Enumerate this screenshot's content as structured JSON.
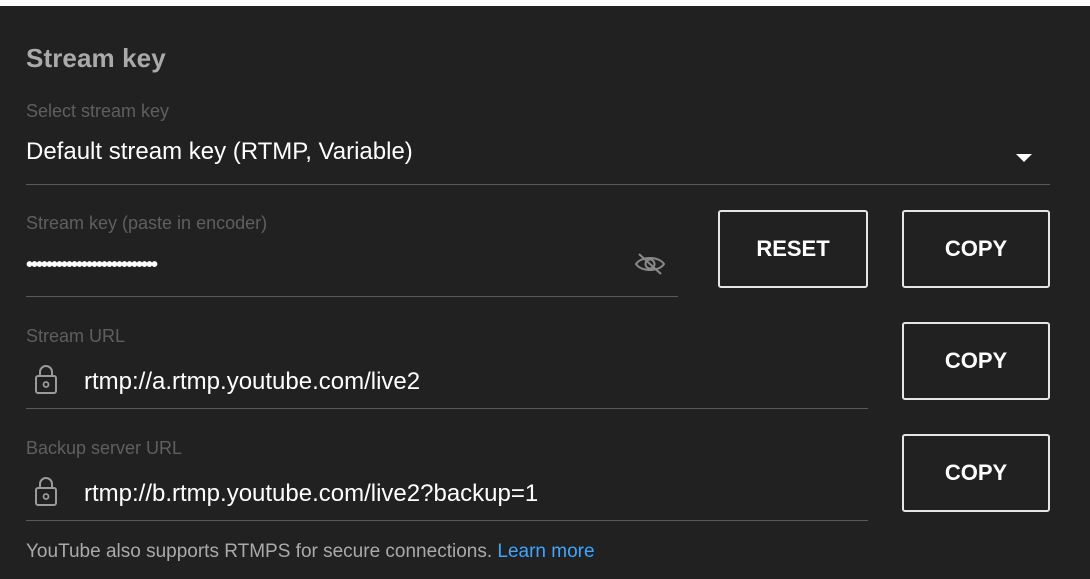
{
  "section": {
    "title": "Stream key"
  },
  "select_stream_key": {
    "label": "Select stream key",
    "value": "Default stream key (RTMP, Variable)"
  },
  "stream_key": {
    "label": "Stream key (paste in encoder)",
    "masked_value": "••••••••••••••••••••••••••",
    "reset_label": "RESET",
    "copy_label": "COPY"
  },
  "stream_url": {
    "label": "Stream URL",
    "value": "rtmp://a.rtmp.youtube.com/live2",
    "copy_label": "COPY"
  },
  "backup_url": {
    "label": "Backup server URL",
    "value": "rtmp://b.rtmp.youtube.com/live2?backup=1",
    "copy_label": "COPY"
  },
  "footer": {
    "text": "YouTube also supports RTMPS for secure connections. ",
    "link": "Learn more"
  },
  "colors": {
    "background": "#212121",
    "link": "#3ea6ff",
    "label": "#5f5f5f",
    "title": "#aaaaaa"
  },
  "icons": {
    "dropdown": "caret-down-icon",
    "visibility": "eye-off-icon",
    "lock": "lock-icon"
  }
}
